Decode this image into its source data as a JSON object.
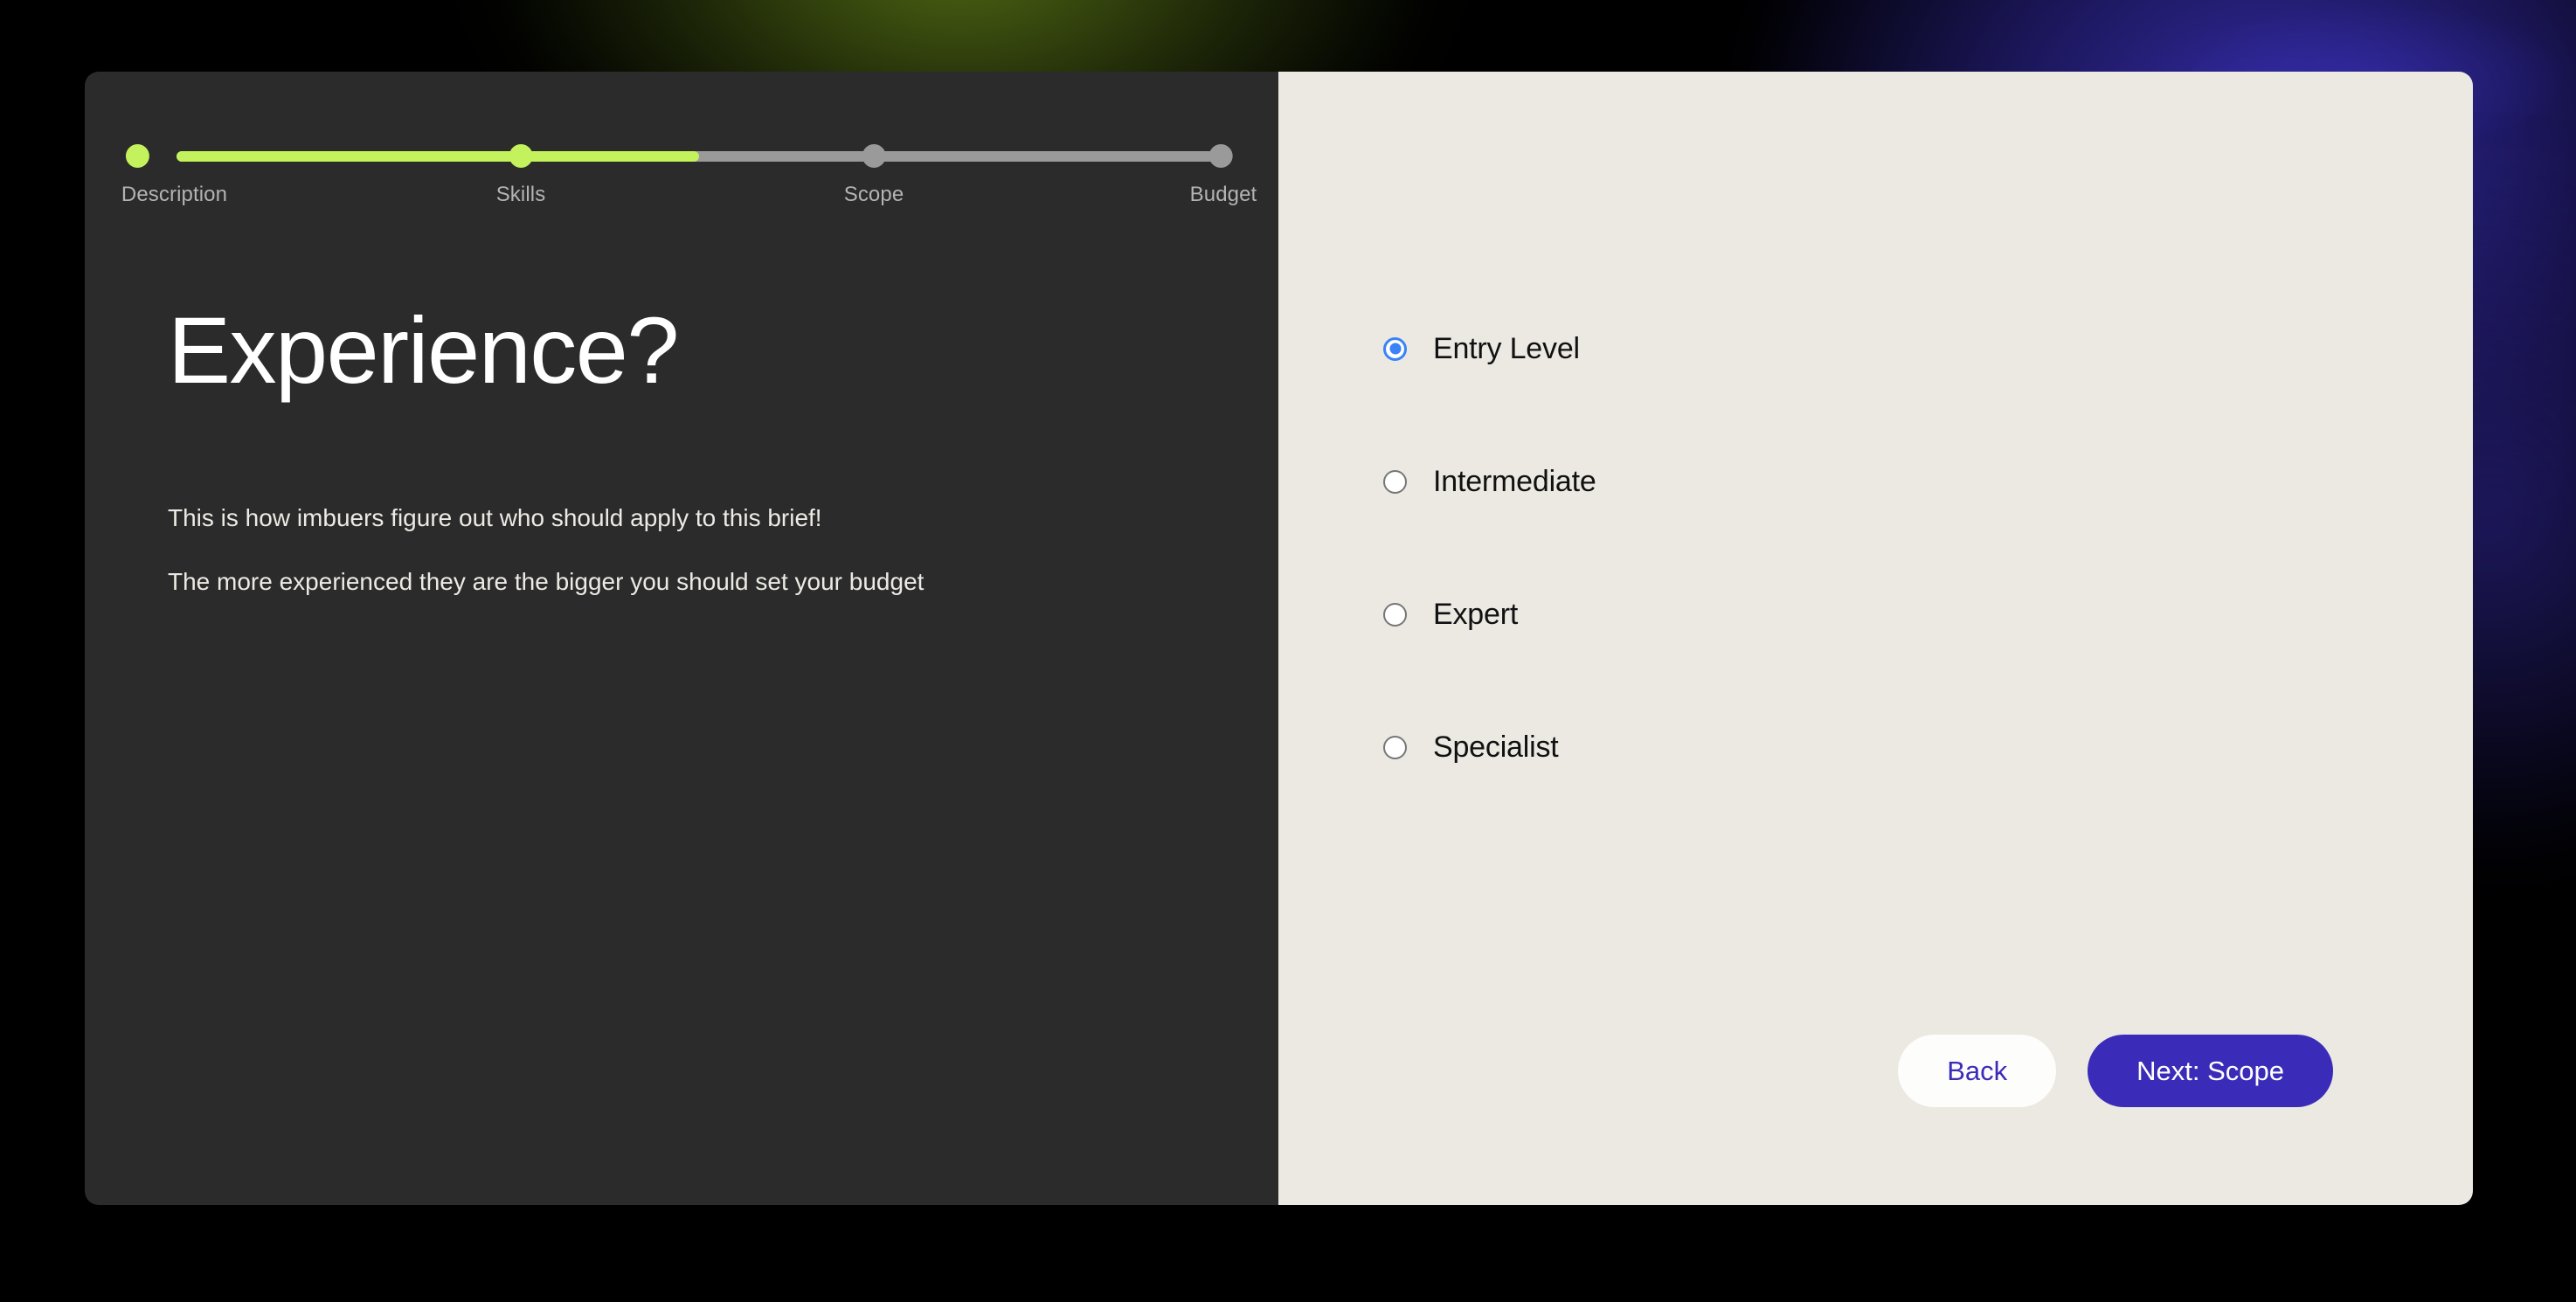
{
  "theme": {
    "accent_lime": "#c3f25c",
    "panel_dark": "#2b2b2b",
    "panel_cream": "#ebe9e2",
    "indigo": "#3a2cb8",
    "radio_blue": "#3b82f6",
    "track_gray": "#9a9a9a"
  },
  "stepper": {
    "current_step_index": 1,
    "steps": [
      {
        "label": "Description",
        "state": "done"
      },
      {
        "label": "Skills",
        "state": "done"
      },
      {
        "label": "Scope",
        "state": "upcoming"
      },
      {
        "label": "Budget",
        "state": "upcoming"
      }
    ]
  },
  "left": {
    "headline": "Experience?",
    "paragraphs": [
      "This is how imbuers figure out who should apply to this brief!",
      "The more experienced they are the bigger you should set your budget"
    ]
  },
  "right": {
    "options": [
      {
        "label": "Entry Level",
        "selected": true
      },
      {
        "label": "Intermediate",
        "selected": false
      },
      {
        "label": "Expert",
        "selected": false
      },
      {
        "label": "Specialist",
        "selected": false
      }
    ],
    "actions": {
      "back_label": "Back",
      "next_label": "Next: Scope"
    }
  }
}
